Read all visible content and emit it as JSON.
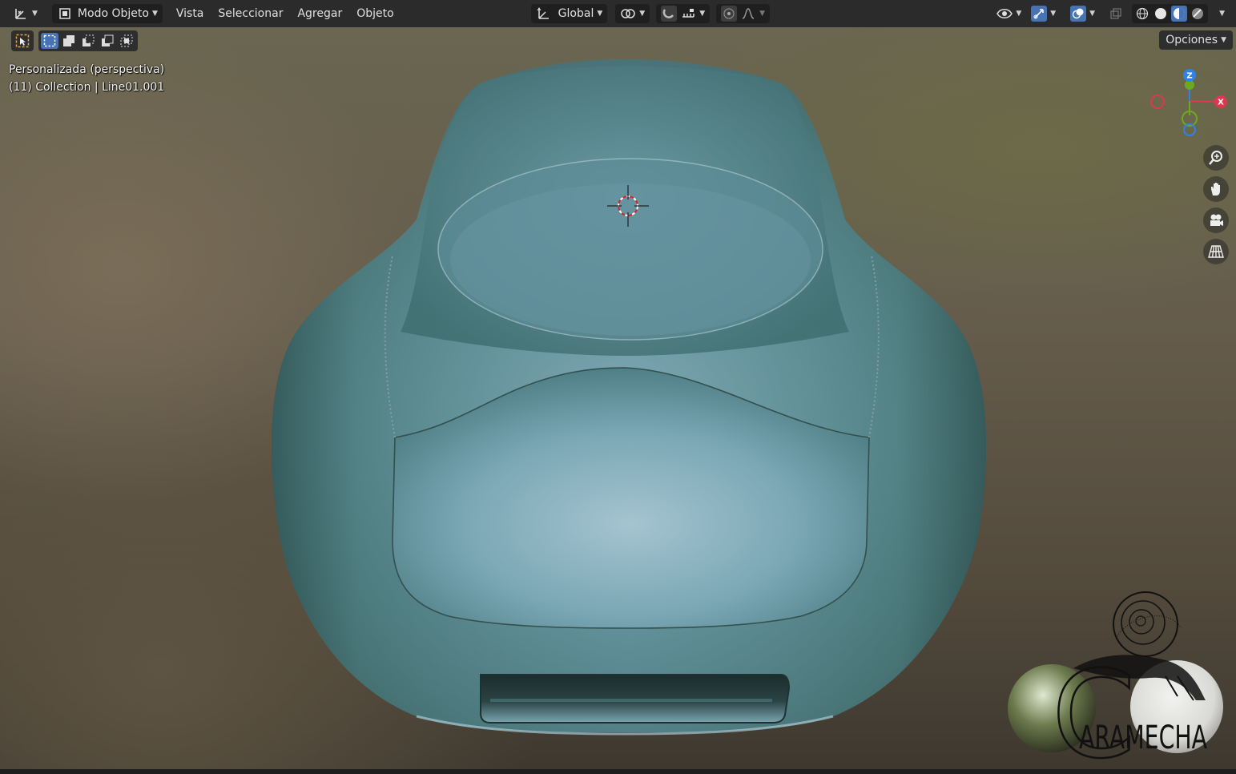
{
  "header": {
    "editor_type_icon": "axis-gizmo-icon",
    "mode": {
      "label": "Modo Objeto",
      "icon": "object-mode-icon"
    },
    "menus": [
      "Vista",
      "Seleccionar",
      "Agregar",
      "Objeto"
    ],
    "transform_orientation": "Global",
    "pivot_icon": "pivot-point-icon",
    "snap_icon": "snap-magnet-icon",
    "snap_target_icon": "snap-increment-icon",
    "proportional_icon": "proportional-editing-icon",
    "falloff_icon": "falloff-curve-icon",
    "visibility_icon": "eye-visibility-icon",
    "gizmo_icon": "gizmo-toggle-icon",
    "overlay_icon": "overlay-toggle-icon",
    "xray_icon": "xray-icon",
    "shading_modes": [
      "wireframe",
      "solid",
      "material-preview",
      "rendered"
    ],
    "active_shading": "material-preview"
  },
  "toolbar": {
    "select_tool_icon": "select-box-cursor-icon",
    "select_modes": [
      "new",
      "extend",
      "subtract",
      "invert",
      "intersect"
    ],
    "active_select_mode": "new",
    "options_label": "Opciones"
  },
  "viewport": {
    "view_name": "Personalizada (perspectiva)",
    "collection_info": "(11) Collection | Line01.001",
    "nav_gizmo": {
      "z": "Z",
      "x": "X"
    },
    "nav_buttons": [
      "zoom-icon",
      "hand-pan-icon",
      "camera-icon",
      "grid-ortho-icon"
    ]
  },
  "watermark": {
    "text": "ARAMECHA",
    "initial": "C"
  },
  "colors": {
    "header_bg": "#2b2b2b",
    "accent_blue": "#4772b3",
    "axis_x": "#e0364f",
    "axis_y": "#6ea81f",
    "axis_z": "#2f83e6"
  }
}
